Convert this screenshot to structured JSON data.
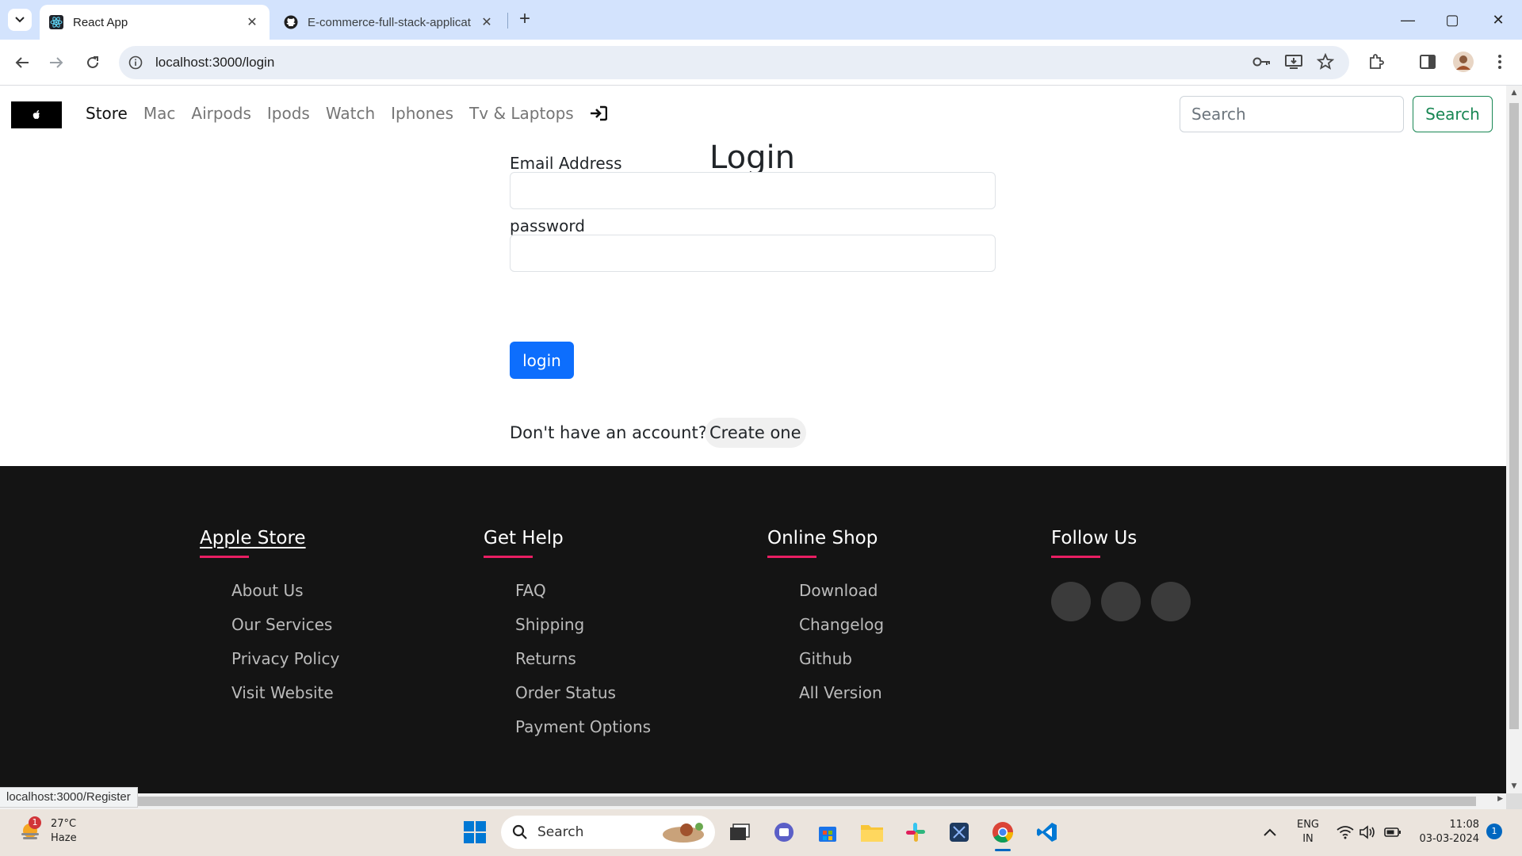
{
  "browser": {
    "tabs": [
      {
        "title": "React App",
        "active": true
      },
      {
        "title": "E-commerce-full-stack-applicat",
        "active": false
      }
    ],
    "new_tab_label": "+",
    "url": "localhost:3000/login",
    "window_controls": {
      "minimize": "—",
      "maximize": "▢",
      "close": "✕"
    }
  },
  "navbar": {
    "logo_glyph": "",
    "links": [
      "Store",
      "Mac",
      "Airpods",
      "Ipods",
      "Watch",
      "Iphones",
      "Tv & Laptops"
    ],
    "active_link": "Store",
    "search_placeholder": "Search",
    "search_button": "Search"
  },
  "login": {
    "title": "Login",
    "email_label": "Email Address",
    "email_value": "",
    "password_label": "password",
    "password_value": "",
    "submit": "login",
    "no_account": "Don't have an account?",
    "create_link": "Create one"
  },
  "footer": {
    "columns": [
      {
        "heading": "Apple Store",
        "items": [
          "About Us",
          "Our Services",
          "Privacy Policy",
          "Visit Website"
        ]
      },
      {
        "heading": "Get Help",
        "items": [
          "FAQ",
          "Shipping",
          "Returns",
          "Order Status",
          "Payment Options"
        ]
      },
      {
        "heading": "Online Shop",
        "items": [
          "Download",
          "Changelog",
          "Github",
          "All Version"
        ]
      },
      {
        "heading": "Follow Us",
        "items": []
      }
    ],
    "accent_color": "#e91e63"
  },
  "status_bar": {
    "hover_url": "localhost:3000/Register"
  },
  "taskbar": {
    "weather": {
      "temp": "27°C",
      "condition": "Haze",
      "alert_count": "1"
    },
    "search_label": "Search",
    "language": {
      "lang": "ENG",
      "region": "IN"
    },
    "clock": {
      "time": "11:08",
      "date": "03-03-2024"
    },
    "notification_count": "1"
  }
}
